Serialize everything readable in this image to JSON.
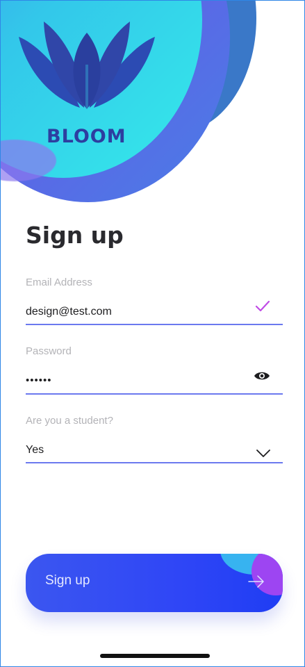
{
  "brand": {
    "name": "BLOOM"
  },
  "screen": {
    "title": "Sign up"
  },
  "form": {
    "email": {
      "label": "Email Address",
      "value": "design@test.com",
      "status_icon": "checkmark-icon"
    },
    "password": {
      "label": "Password",
      "value": "••••••",
      "toggle_icon": "eye-icon"
    },
    "student": {
      "label": "Are you a student?",
      "value": "Yes",
      "dropdown_icon": "chevron-down-icon"
    }
  },
  "submit": {
    "label": "Sign up",
    "icon": "arrow-right-icon"
  },
  "colors": {
    "accent": "#6b79ef",
    "button_start": "#3b56f0",
    "button_end": "#1f3df4",
    "brand_text": "#2d3ea0",
    "check": "#c04be6"
  }
}
